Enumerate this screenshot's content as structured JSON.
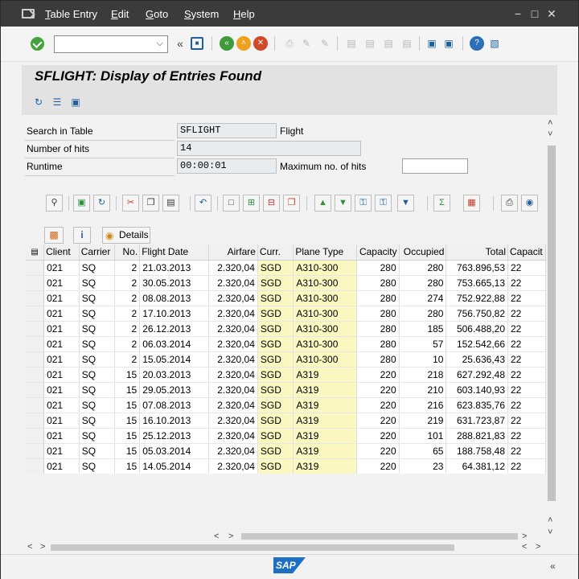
{
  "menu": {
    "items": [
      {
        "first": "T",
        "rest": "able Entry"
      },
      {
        "first": "E",
        "rest": "dit"
      },
      {
        "first": "G",
        "rest": "oto"
      },
      {
        "first": "S",
        "rest": "ystem"
      },
      {
        "first": "H",
        "rest": "elp"
      }
    ]
  },
  "window_controls": {
    "minimize": "−",
    "maximize": "□",
    "close": "✕"
  },
  "command_field": {
    "value": "",
    "dropdown_icon": "chevron-down-icon"
  },
  "title": "SFLIGHT: Display of Entries Found",
  "form": {
    "search_label": "Search in Table",
    "search_value": "SFLIGHT",
    "search_desc": "Flight",
    "hits_label": "Number of hits",
    "hits_value": "14",
    "runtime_label": "Runtime",
    "runtime_value": "00:00:01",
    "max_label": "Maximum no. of hits",
    "max_value": ""
  },
  "grid_buttons": {
    "details": "Details"
  },
  "columns": [
    "Client",
    "Carrier",
    "No.",
    "Flight Date",
    "Airfare",
    "Curr.",
    "Plane Type",
    "Capacity",
    "Occupied",
    "Total",
    "Capacit"
  ],
  "rows": [
    [
      "021",
      "SQ",
      "2",
      "21.03.2013",
      "2.320,04",
      "SGD",
      "A310-300",
      "280",
      "280",
      "763.896,53",
      "22"
    ],
    [
      "021",
      "SQ",
      "2",
      "30.05.2013",
      "2.320,04",
      "SGD",
      "A310-300",
      "280",
      "280",
      "753.665,13",
      "22"
    ],
    [
      "021",
      "SQ",
      "2",
      "08.08.2013",
      "2.320,04",
      "SGD",
      "A310-300",
      "280",
      "274",
      "752.922,88",
      "22"
    ],
    [
      "021",
      "SQ",
      "2",
      "17.10.2013",
      "2.320,04",
      "SGD",
      "A310-300",
      "280",
      "280",
      "756.750,82",
      "22"
    ],
    [
      "021",
      "SQ",
      "2",
      "26.12.2013",
      "2.320,04",
      "SGD",
      "A310-300",
      "280",
      "185",
      "506.488,20",
      "22"
    ],
    [
      "021",
      "SQ",
      "2",
      "06.03.2014",
      "2.320,04",
      "SGD",
      "A310-300",
      "280",
      "57",
      "152.542,66",
      "22"
    ],
    [
      "021",
      "SQ",
      "2",
      "15.05.2014",
      "2.320,04",
      "SGD",
      "A310-300",
      "280",
      "10",
      "25.636,43",
      "22"
    ],
    [
      "021",
      "SQ",
      "15",
      "20.03.2013",
      "2.320,04",
      "SGD",
      "A319",
      "220",
      "218",
      "627.292,48",
      "22"
    ],
    [
      "021",
      "SQ",
      "15",
      "29.05.2013",
      "2.320,04",
      "SGD",
      "A319",
      "220",
      "210",
      "603.140,93",
      "22"
    ],
    [
      "021",
      "SQ",
      "15",
      "07.08.2013",
      "2.320,04",
      "SGD",
      "A319",
      "220",
      "216",
      "623.835,76",
      "22"
    ],
    [
      "021",
      "SQ",
      "15",
      "16.10.2013",
      "2.320,04",
      "SGD",
      "A319",
      "220",
      "219",
      "631.723,87",
      "22"
    ],
    [
      "021",
      "SQ",
      "15",
      "25.12.2013",
      "2.320,04",
      "SGD",
      "A319",
      "220",
      "101",
      "288.821,83",
      "22"
    ],
    [
      "021",
      "SQ",
      "15",
      "05.03.2014",
      "2.320,04",
      "SGD",
      "A319",
      "220",
      "65",
      "188.758,48",
      "22"
    ],
    [
      "021",
      "SQ",
      "15",
      "14.05.2014",
      "2.320,04",
      "SGD",
      "A319",
      "220",
      "23",
      "64.381,12",
      "22"
    ]
  ],
  "logo": "SAP"
}
